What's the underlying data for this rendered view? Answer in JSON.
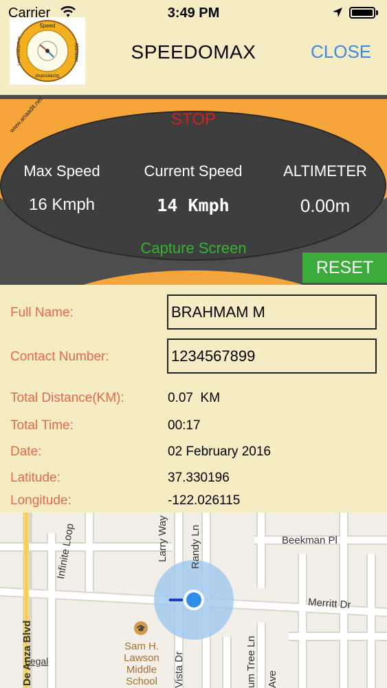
{
  "status_bar": {
    "carrier": "Carrier",
    "time": "3:49 PM"
  },
  "header": {
    "title": "SPEEDOMAX",
    "close_label": "CLOSE",
    "logo_text_top": "Speed",
    "logo_text_right": "Altimeter",
    "logo_text_bottom": "Screenshot",
    "logo_text_left": "Location/Map/Time"
  },
  "dashboard": {
    "site": "www.anaadit.net",
    "stop_label": "STOP",
    "max_speed_label": "Max Speed",
    "max_speed_value": "16 Kmph",
    "current_speed_label": "Current Speed",
    "current_speed_value": "14 Kmph",
    "altimeter_label": "ALTIMETER",
    "altimeter_value": "0.00m",
    "capture_label": "Capture Screen",
    "reset_label": "RESET",
    "colors": {
      "orange": "#f5a53a",
      "panel": "#3e3e3e",
      "stop": "#d42020",
      "capture": "#2fb52f",
      "reset": "#3cab3c"
    }
  },
  "form": {
    "full_name_label": "Full Name:",
    "full_name_value": "BRAHMAM M",
    "contact_label": "Contact Number:",
    "contact_value": "1234567899",
    "distance_label": "Total Distance(KM):",
    "distance_value": "0.07  KM",
    "time_label": "Total Time:",
    "time_value": "00:17",
    "date_label": "Date:",
    "date_value": "02 February 2016",
    "latitude_label": "Latitude:",
    "latitude_value": "37.330196",
    "longitude_label": "Longitude:",
    "longitude_value": "-122.026115"
  },
  "map": {
    "streets": {
      "infinite_loop": "Infinite Loop",
      "larry_way": "Larry Way",
      "randy_ln": "Randy Ln",
      "beekman_pl": "Beekman Pl",
      "merritt_dr": "Merritt Dr",
      "de_anza_blvd": "De Anza Blvd",
      "vista_dr": "Vista Dr",
      "plum_tree_ln": "um Tree Ln",
      "ave": "Ave"
    },
    "school_lines": [
      "Sam H.",
      "Lawson",
      "Middle",
      "School"
    ],
    "legal": "Legal"
  }
}
